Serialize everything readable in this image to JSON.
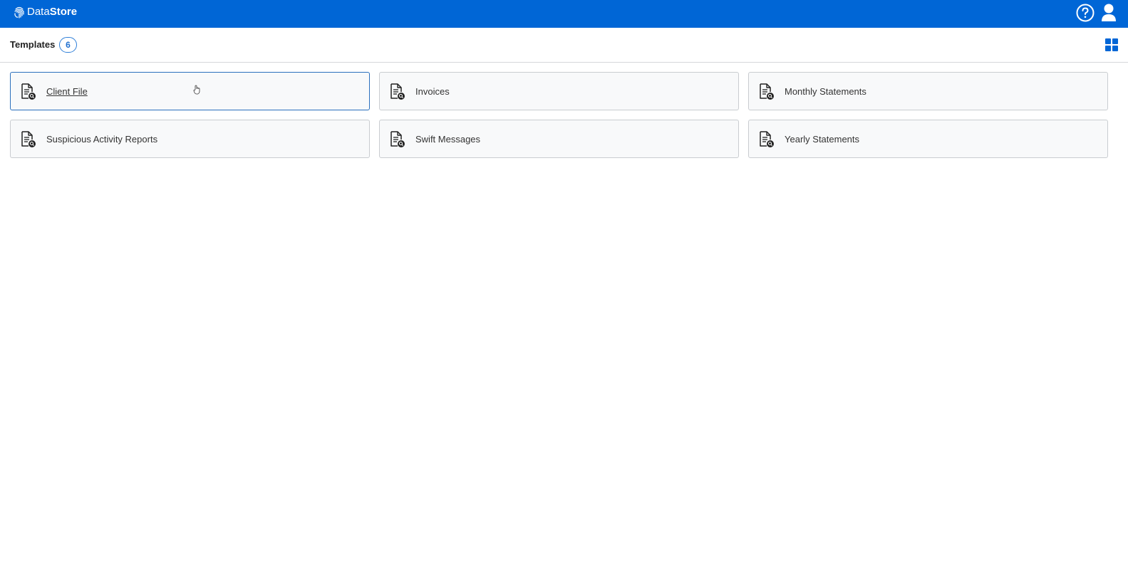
{
  "app": {
    "logo_light": "Data",
    "logo_bold": "Store",
    "logo_icon": "fingerprint-logo"
  },
  "header": {
    "help_icon": "help-circle-icon",
    "user_icon": "user-icon"
  },
  "subheader": {
    "title": "Templates",
    "count": "6",
    "view_toggle_icon": "grid-view-icon"
  },
  "templates": [
    {
      "label": "Client File",
      "icon": "document-search-icon",
      "state": "hovered"
    },
    {
      "label": "Invoices",
      "icon": "document-search-icon"
    },
    {
      "label": "Monthly Statements",
      "icon": "document-search-icon"
    },
    {
      "label": "Suspicious Activity Reports",
      "icon": "document-search-icon"
    },
    {
      "label": "Swift Messages",
      "icon": "document-search-icon"
    },
    {
      "label": "Yearly Statements",
      "icon": "document-search-icon"
    }
  ],
  "colors": {
    "brand": "#0066d6",
    "accent": "#1f6fcf",
    "card_bg": "#f8f9fa",
    "card_border": "#c9ccd0"
  }
}
